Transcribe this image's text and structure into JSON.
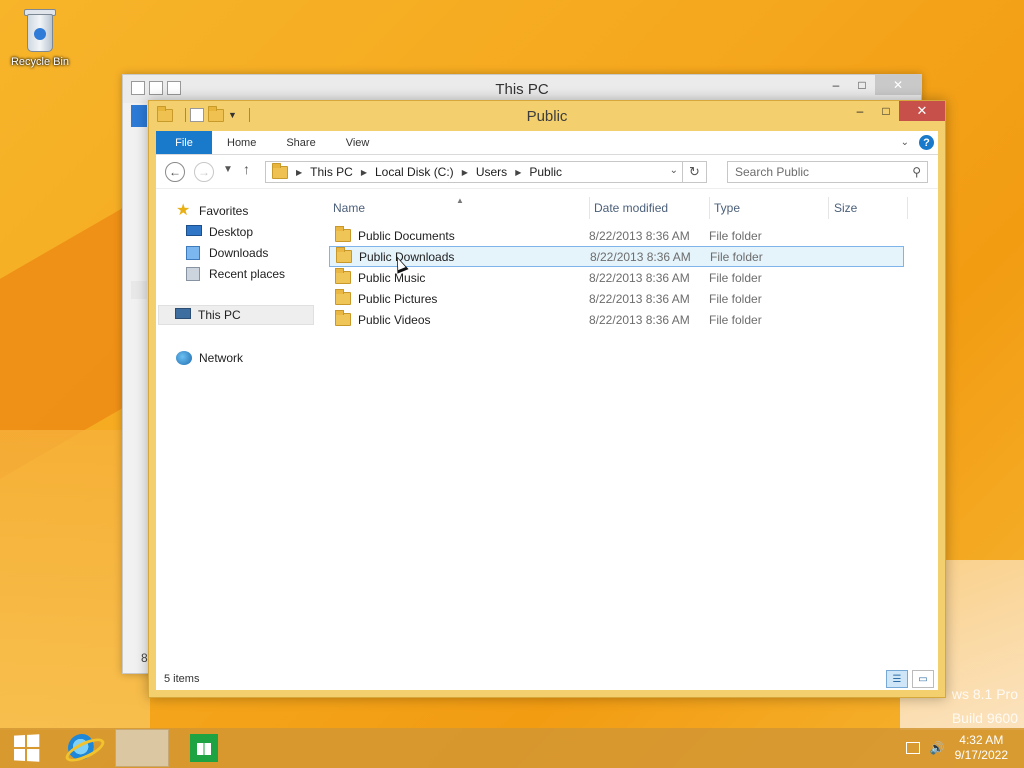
{
  "desktop": {
    "recycle_bin_label": "Recycle Bin",
    "watermark_line1": "ws 8.1 Pro",
    "watermark_line2": "Build 9600"
  },
  "back_window": {
    "title": "This PC",
    "footer_fragment": "8"
  },
  "window": {
    "title": "Public",
    "caption": {
      "minimize": "–",
      "maximize": "□",
      "close": "✕"
    },
    "ribbon_tabs": [
      "File",
      "Home",
      "Share",
      "View"
    ],
    "address": {
      "crumbs": [
        "This PC",
        "Local Disk (C:)",
        "Users",
        "Public"
      ]
    },
    "search_placeholder": "Search Public",
    "nav_pane": {
      "favorites_label": "Favorites",
      "favorites": [
        "Desktop",
        "Downloads",
        "Recent places"
      ],
      "this_pc_label": "This PC",
      "network_label": "Network"
    },
    "columns": [
      "Name",
      "Date modified",
      "Type",
      "Size"
    ],
    "files": [
      {
        "name": "Public Documents",
        "date": "8/22/2013 8:36 AM",
        "type": "File folder"
      },
      {
        "name": "Public Downloads",
        "date": "8/22/2013 8:36 AM",
        "type": "File folder"
      },
      {
        "name": "Public Music",
        "date": "8/22/2013 8:36 AM",
        "type": "File folder"
      },
      {
        "name": "Public Pictures",
        "date": "8/22/2013 8:36 AM",
        "type": "File folder"
      },
      {
        "name": "Public Videos",
        "date": "8/22/2013 8:36 AM",
        "type": "File folder"
      }
    ],
    "selected_row": 1,
    "status_text": "5 items"
  },
  "taskbar": {
    "time": "4:32 AM",
    "date": "9/17/2022"
  },
  "colors": {
    "accent": "#1979ca",
    "window_frame": "#f3cf6d",
    "close_button": "#c7504a",
    "selection": "#e5f3fb"
  }
}
